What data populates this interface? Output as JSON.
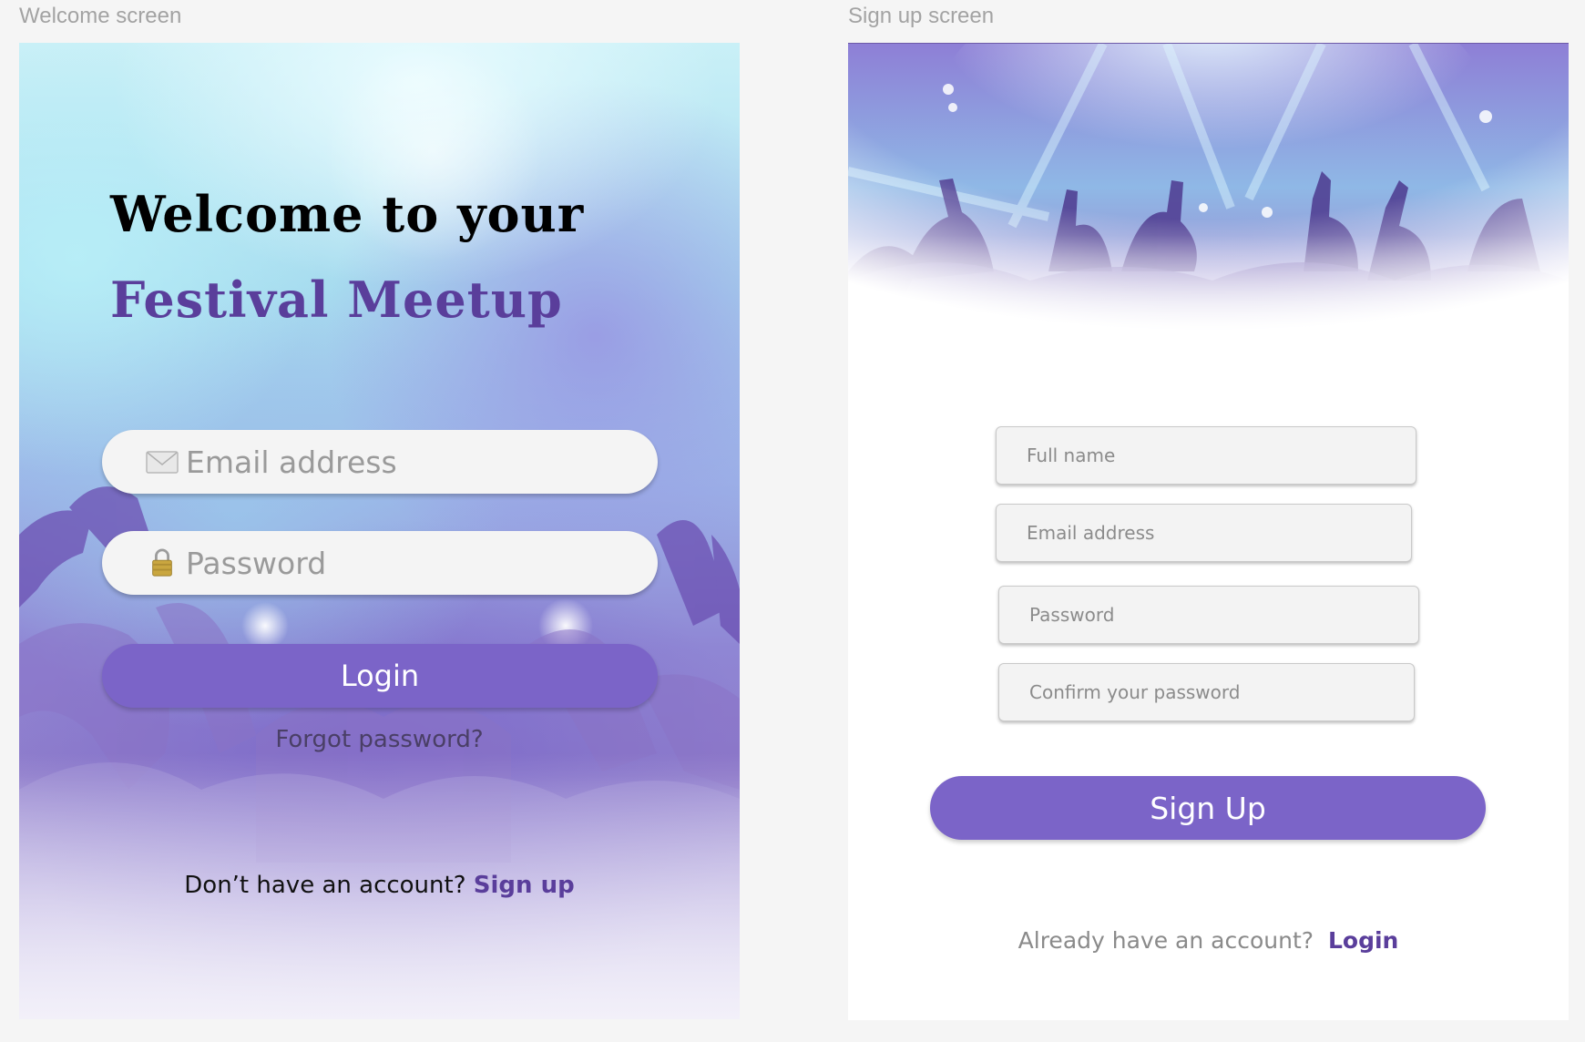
{
  "frames": {
    "welcome_label": "Welcome screen",
    "signup_label": "Sign up screen"
  },
  "welcome": {
    "title_line1": "Welcome to your",
    "title_line2": "Festival Meetup",
    "email_placeholder": "Email address",
    "email_icon": "envelope-icon",
    "password_placeholder": "Password",
    "password_icon": "lock-icon",
    "login_label": "Login",
    "forgot_label": "Forgot password?",
    "no_account_text": "Don’t have an account?",
    "signup_link": "Sign up"
  },
  "signup": {
    "fullname_placeholder": "Full name",
    "email_placeholder": "Email address",
    "password_placeholder": "Password",
    "confirm_placeholder": "Confirm your password",
    "signup_label": "Sign Up",
    "have_account_text": "Already have an account?",
    "login_link": "Login"
  },
  "colors": {
    "accent": "#7b64c8",
    "brand_text": "#5a3e9b",
    "page_background": "#f5f5f5"
  }
}
